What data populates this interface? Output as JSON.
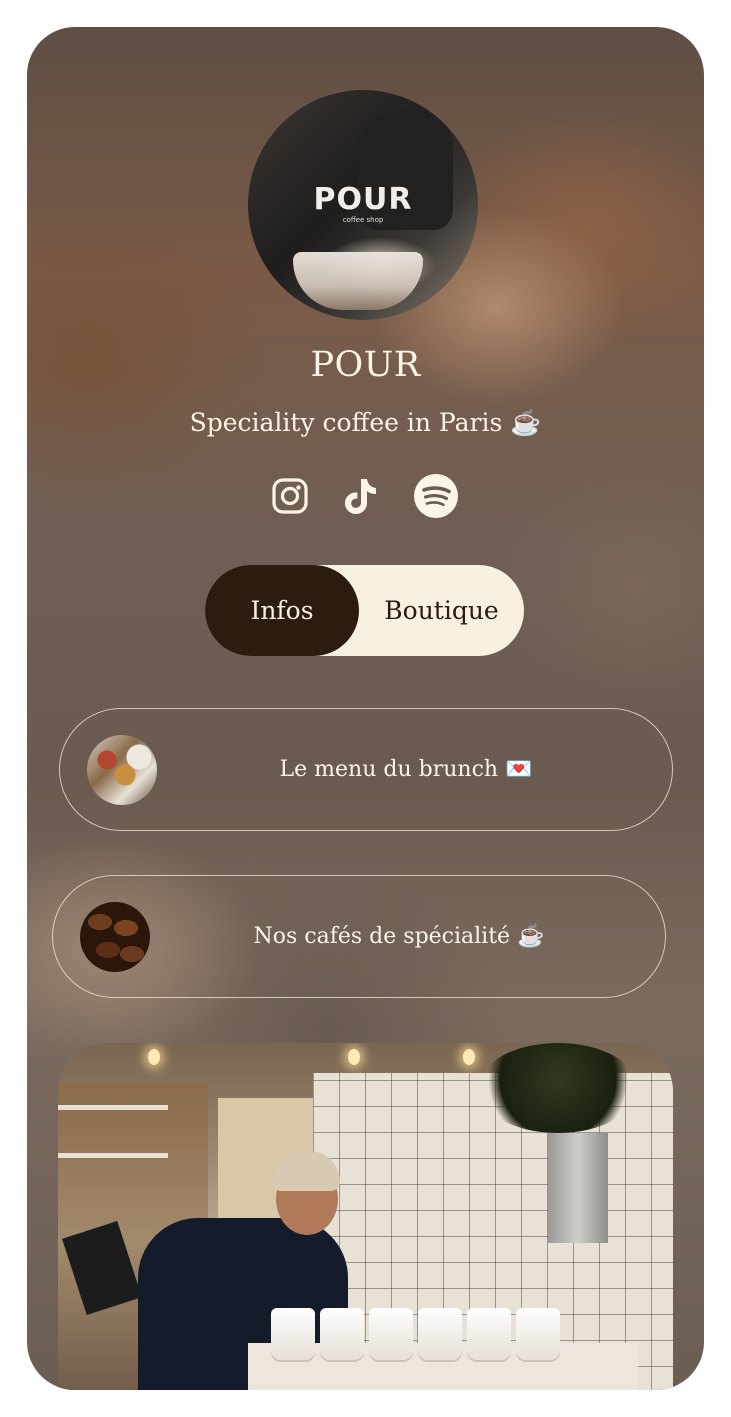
{
  "profile": {
    "avatar_logo": "POUR",
    "avatar_logo_sub": "coffee shop",
    "name": "POUR",
    "tagline": "Speciality coffee in Paris ☕"
  },
  "socials": [
    {
      "name": "instagram-icon",
      "label": "Instagram"
    },
    {
      "name": "tiktok-icon",
      "label": "TikTok"
    },
    {
      "name": "spotify-icon",
      "label": "Spotify"
    }
  ],
  "tabs": {
    "active_label": "Infos",
    "inactive_label": "Boutique"
  },
  "links": [
    {
      "label": "Le menu du brunch 💌"
    },
    {
      "label": "Nos cafés de spécialité ☕"
    }
  ],
  "colors": {
    "cream": "#fbf5e8",
    "dark_brown": "#2c1c0f",
    "toggle_bg": "#f8f1e1"
  }
}
